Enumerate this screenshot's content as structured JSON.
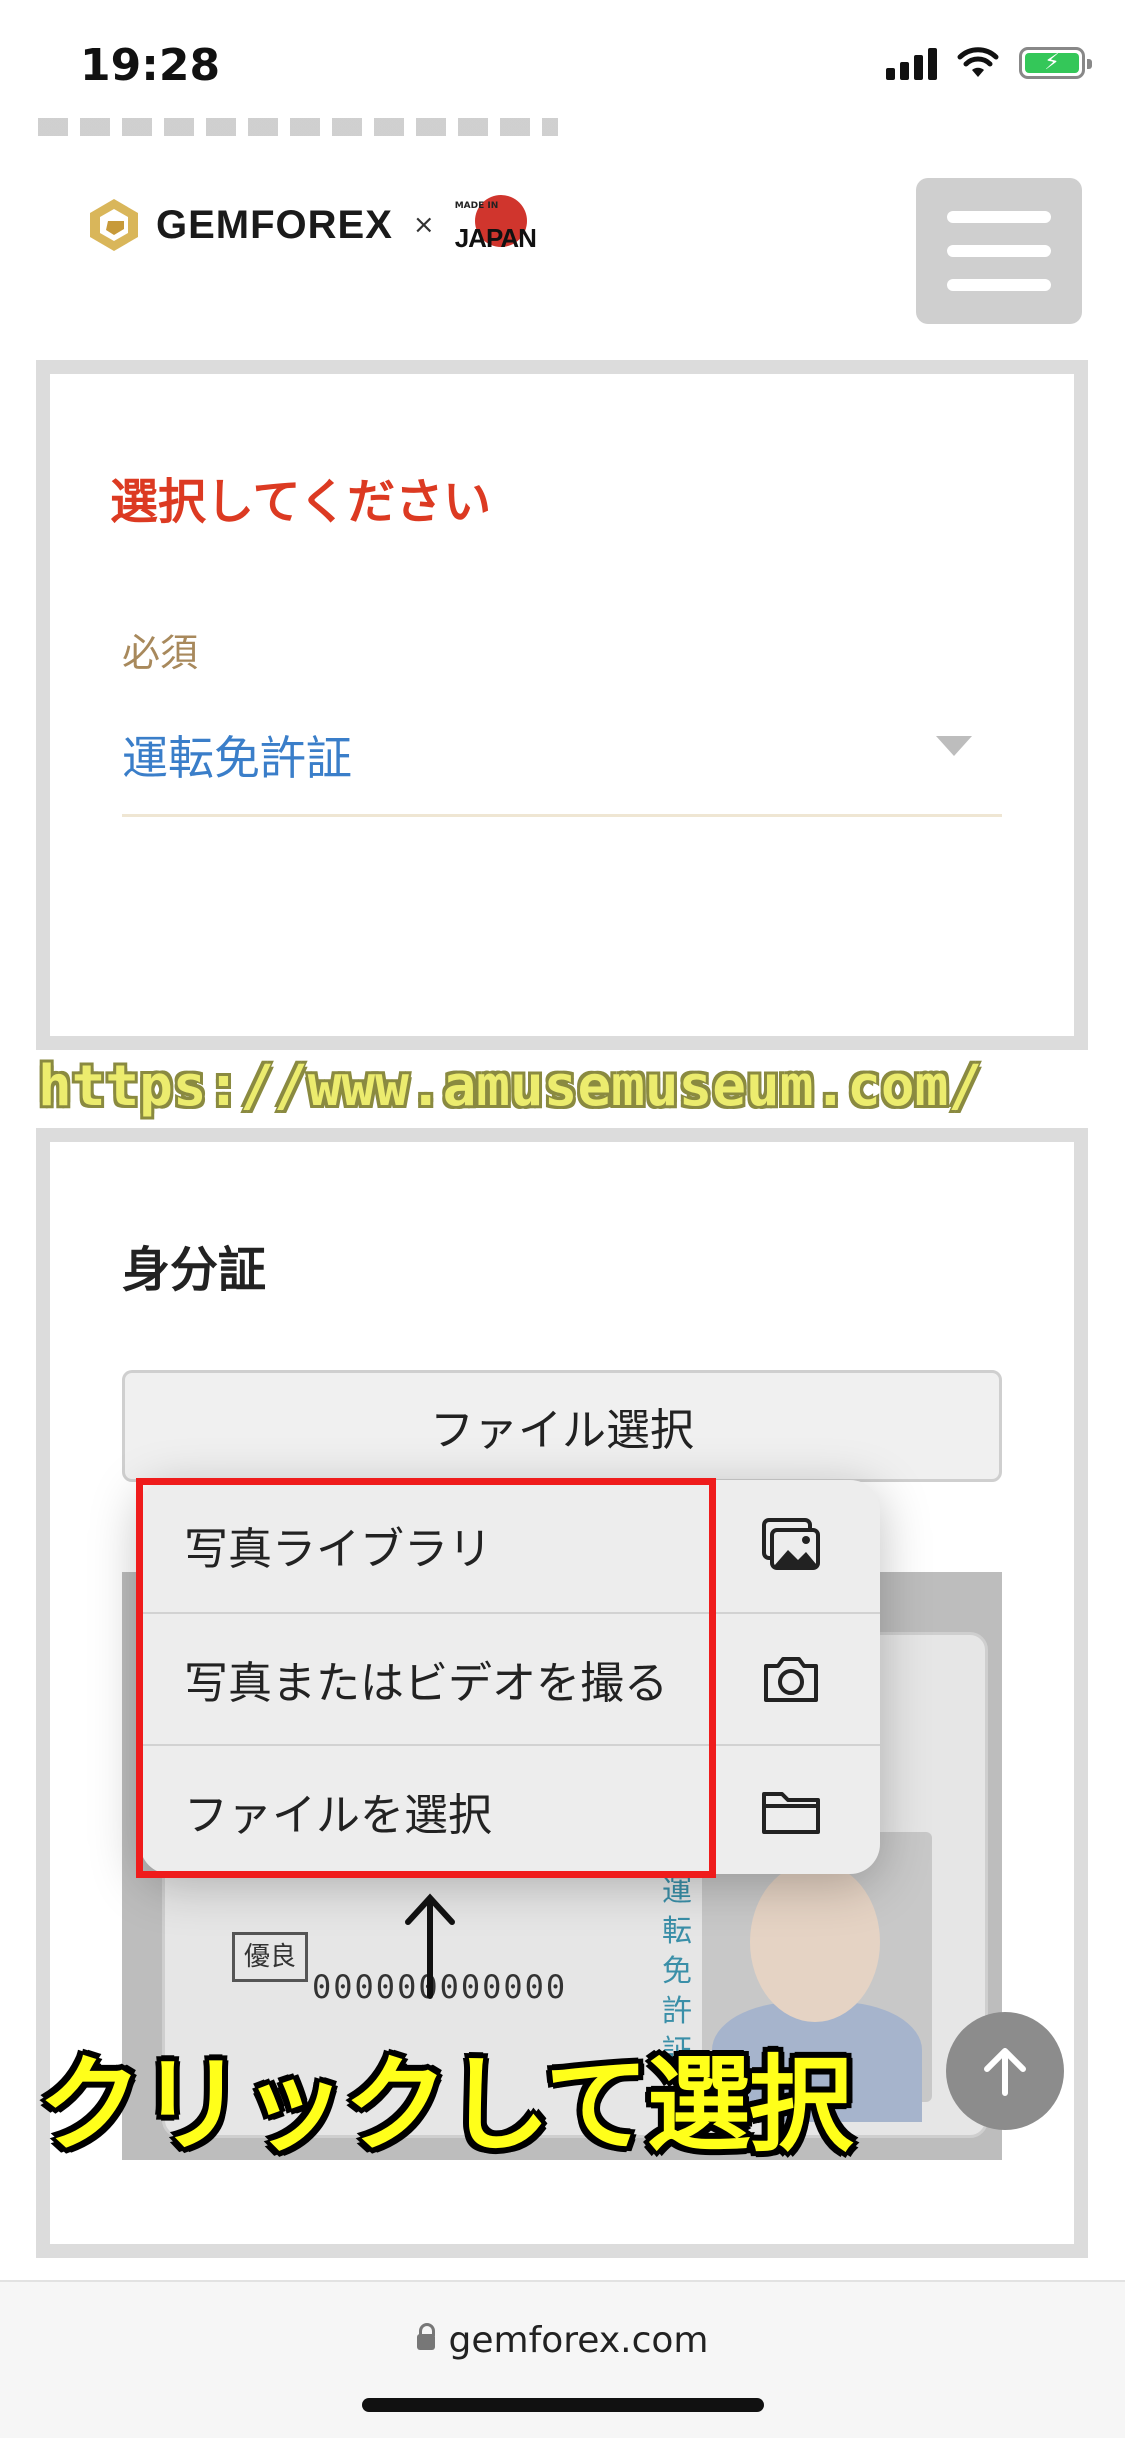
{
  "status_bar": {
    "time": "19:28"
  },
  "header": {
    "brand": "GEMFOREX",
    "separator": "×",
    "made_in": "MADE IN",
    "partner": "JAPAN"
  },
  "doc_select": {
    "title": "選択してください",
    "required_label": "必須",
    "selected_value": "運転免許証"
  },
  "watermark_url": "https://www.amusemuseum.com/",
  "id_section": {
    "title": "身分証",
    "file_button": "ファイル選択"
  },
  "license_sample": {
    "badge": "優良",
    "number": "000000000000",
    "vertical_text": "運転免許証"
  },
  "popup_menu": {
    "items": [
      {
        "label": "写真ライブラリ",
        "icon": "photo-library-icon"
      },
      {
        "label": "写真またはビデオを撮る",
        "icon": "camera-icon"
      },
      {
        "label": "ファイルを選択",
        "icon": "folder-icon"
      }
    ]
  },
  "annotation": {
    "arrow": "↑",
    "text": "クリックして選択"
  },
  "browser": {
    "url": "gemforex.com"
  },
  "colors": {
    "accent_red": "#dc3a22",
    "link_blue": "#3a7ec9",
    "highlight": "#ef1c1c",
    "annotation_yellow": "#ffff1a"
  }
}
